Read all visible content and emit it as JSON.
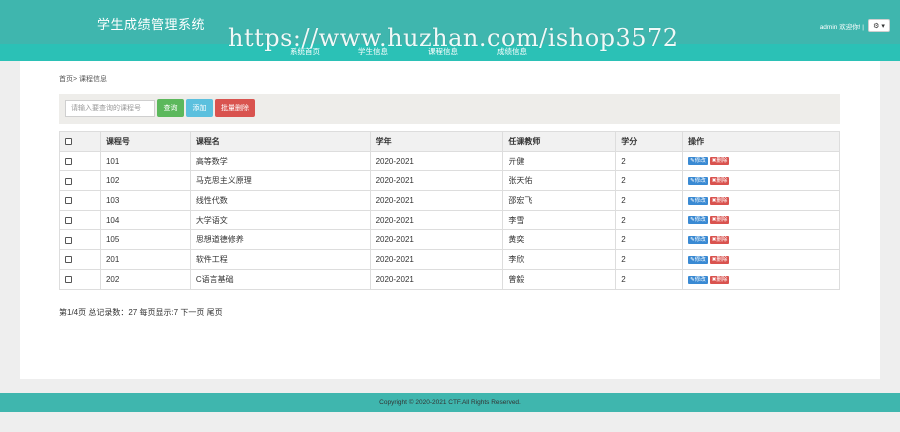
{
  "header": {
    "title": "学生成绩管理系统",
    "user_text": "admin 欢迎你! |",
    "settings_icon": "gear-icon",
    "nav": [
      "系统首页",
      "学生信息",
      "课程信息",
      "成绩信息"
    ],
    "watermark": "https://www.huzhan.com/ishop3572"
  },
  "breadcrumb": "首页> 课程信息",
  "search": {
    "placeholder": "请输入要查询的课程号",
    "query_label": "查询",
    "add_label": "添加",
    "batch_delete_label": "批量删除"
  },
  "table": {
    "columns": [
      "课程号",
      "课程名",
      "学年",
      "任课教师",
      "学分",
      "操作"
    ],
    "rows": [
      {
        "id": "101",
        "name": "高等数学",
        "year": "2020-2021",
        "teacher": "亓健",
        "credit": "2"
      },
      {
        "id": "102",
        "name": "马克思主义原理",
        "year": "2020-2021",
        "teacher": "张天佑",
        "credit": "2"
      },
      {
        "id": "103",
        "name": "线性代数",
        "year": "2020-2021",
        "teacher": "邵宏飞",
        "credit": "2"
      },
      {
        "id": "104",
        "name": "大学语文",
        "year": "2020-2021",
        "teacher": "李雪",
        "credit": "2"
      },
      {
        "id": "105",
        "name": "思想道德修养",
        "year": "2020-2021",
        "teacher": "黄奕",
        "credit": "2"
      },
      {
        "id": "201",
        "name": "软件工程",
        "year": "2020-2021",
        "teacher": "李欣",
        "credit": "2"
      },
      {
        "id": "202",
        "name": "C语言基础",
        "year": "2020-2021",
        "teacher": "曾毅",
        "credit": "2"
      }
    ],
    "edit_label": "修改",
    "delete_label": "删除"
  },
  "pagination": "第1/4页 总记录数：27 每页显示:7 下一页 尾页",
  "footer": "Copyright © 2020-2021 CTF.All Rights Reserved.",
  "colors": {
    "header": "#3fb6ae",
    "query": "#5cb85c",
    "add": "#5bc0de",
    "danger": "#d9534f",
    "edit": "#3a8ad3"
  }
}
